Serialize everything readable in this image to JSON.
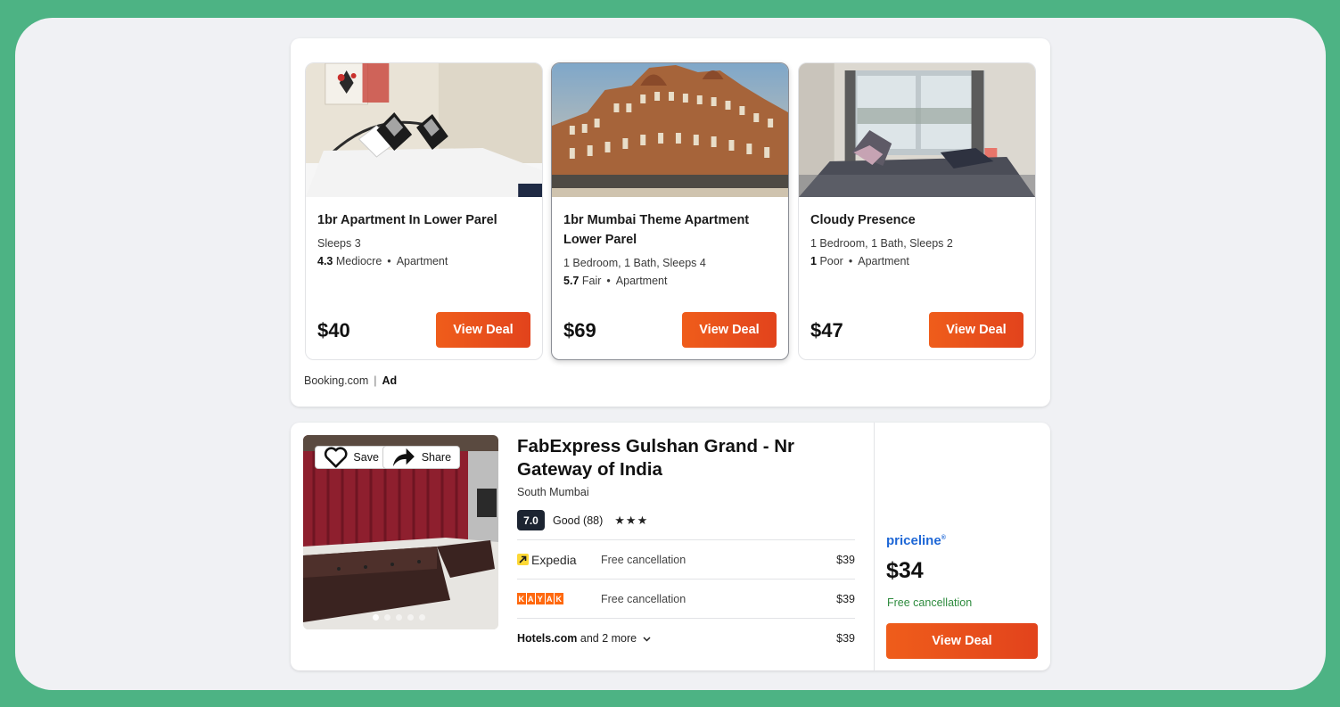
{
  "ad_section": {
    "cards": [
      {
        "title": "1br Apartment In Lower Parel",
        "details": "Sleeps 3",
        "rating_score": "4.3",
        "rating_label": "Mediocre",
        "property_type": "Apartment",
        "price": "$40",
        "button_label": "View Deal"
      },
      {
        "title": "1br Mumbai Theme Apartment Lower Parel",
        "details": "1 Bedroom, 1 Bath, Sleeps 4",
        "rating_score": "5.7",
        "rating_label": "Fair",
        "property_type": "Apartment",
        "price": "$69",
        "button_label": "View Deal"
      },
      {
        "title": "Cloudy Presence",
        "details": "1 Bedroom, 1 Bath, Sleeps 2",
        "rating_score": "1",
        "rating_label": "Poor",
        "property_type": "Apartment",
        "price": "$47",
        "button_label": "View Deal"
      }
    ],
    "source": "Booking.com",
    "separator": "|",
    "ad_label": "Ad"
  },
  "hotel": {
    "save_label": "Save",
    "share_label": "Share",
    "name": "FabExpress Gulshan Grand - Nr Gateway of India",
    "area": "South Mumbai",
    "score": "7.0",
    "score_label": "Good (88)",
    "stars": "★★★",
    "photo_count": 5,
    "offers": [
      {
        "provider": "Expedia",
        "note": "Free cancellation",
        "price": "$39",
        "icon": "expedia-arrow-icon"
      },
      {
        "provider": "KAYAK",
        "note": "Free cancellation",
        "price": "$39",
        "icon": "kayak-logo"
      }
    ],
    "more_provider": "Hotels.com",
    "more_text": "and 2 more",
    "more_price": "$39",
    "best": {
      "provider": "priceline",
      "price": "$34",
      "note": "Free cancellation",
      "button_label": "View Deal"
    }
  },
  "colors": {
    "accent_orange": "#e9521b",
    "green_note": "#2e8b3e",
    "priceline_blue": "#1e67d6",
    "kayak_orange": "#ff690f",
    "background": "#4db384"
  }
}
